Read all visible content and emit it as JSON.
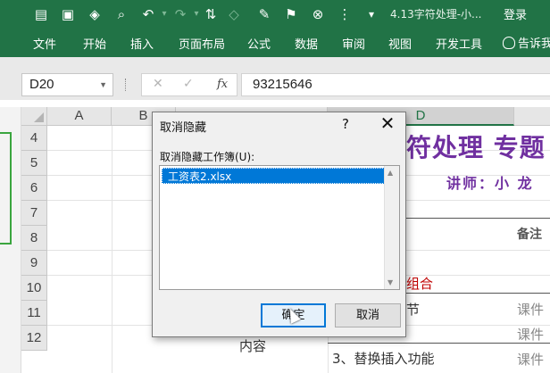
{
  "window": {
    "title": "4.13字符处理-小...",
    "login": "登录"
  },
  "quick_access": [
    "save-icon",
    "save-as-icon",
    "touch-icon",
    "print-preview-icon",
    "undo-icon",
    "redo-icon",
    "sort-icon",
    "shape-icon",
    "comment-icon",
    "flag-icon",
    "clear-icon",
    "dropdown-icon"
  ],
  "ribbon_tabs": [
    "文件",
    "开始",
    "插入",
    "页面布局",
    "公式",
    "数据",
    "审阅",
    "视图",
    "开发工具"
  ],
  "tell_me": "告诉我",
  "formula_bar": {
    "name_box": "D20",
    "formula": "93215646",
    "fx_label": "fx"
  },
  "columns": {
    "a": "A",
    "b": "B",
    "d": "D"
  },
  "rows": [
    "4",
    "5",
    "6",
    "7",
    "8",
    "9",
    "10",
    "11",
    "12"
  ],
  "cells": {
    "title": "符处理 专题",
    "teacher": "讲师：小 龙",
    "note_header": "备注",
    "red_fragment": "组合",
    "d10": "节",
    "course1": "课件",
    "course2": "课件",
    "course3": "课件",
    "content": "内容",
    "replace": "3、替换插入功能"
  },
  "dialog": {
    "title": "取消隐藏",
    "help": "?",
    "close": "✕",
    "list_label": "取消隐藏工作簿(U):",
    "items": [
      "工资表2.xlsx"
    ],
    "ok": "确定",
    "cancel": "取消"
  },
  "colors": {
    "ribbon": "#217346",
    "title_purple": "#7030a0",
    "red": "#c00000",
    "selection": "#0078d7"
  }
}
